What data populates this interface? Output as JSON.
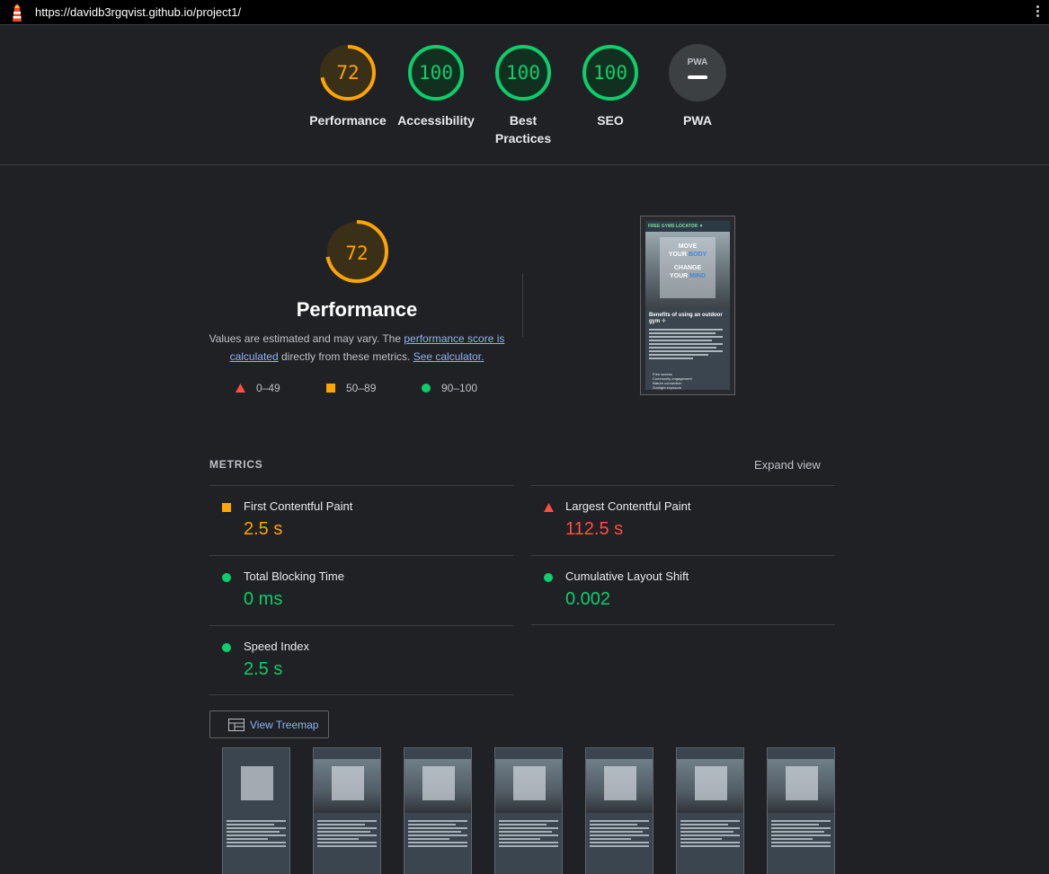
{
  "browser": {
    "url": "https://davidb3rgqvist.github.io/project1/"
  },
  "summary": {
    "categories": [
      {
        "label": "Performance",
        "score": "72",
        "color": "#ffa400"
      },
      {
        "label": "Accessibility",
        "score": "100",
        "color": "#0cce6b"
      },
      {
        "label": "Best Practices",
        "score": "100",
        "color": "#0cce6b"
      },
      {
        "label": "SEO",
        "score": "100",
        "color": "#0cce6b"
      },
      {
        "label": "PWA",
        "score": "",
        "badge": "PWA",
        "color": "#5f6368"
      }
    ]
  },
  "performance": {
    "score": "72",
    "title": "Performance",
    "desc_prefix": "Values are estimated and may vary. The ",
    "desc_link1": "performance score is calculated",
    "desc_mid": " directly from these metrics. ",
    "desc_link2": "See calculator.",
    "legend": [
      {
        "range": "0–49",
        "shape": "triangle",
        "color": "#ff4e42"
      },
      {
        "range": "50–89",
        "shape": "square",
        "color": "#ffa400"
      },
      {
        "range": "90–100",
        "shape": "circle",
        "color": "#0cce6b"
      }
    ]
  },
  "screenshot": {
    "nav": "FREE GYMS LOCATOR ▼",
    "hero_line1": "MOVE",
    "hero_line2a": "YOUR ",
    "hero_line2b": "BODY",
    "hero_line3": "CHANGE",
    "hero_line4a": "YOUR ",
    "hero_line4b": "MIND",
    "heading": "Benefits of using an outdoor gym ✛",
    "list": [
      "Free access",
      "Community engagement",
      "Nature connection",
      "Sunlight exposure"
    ]
  },
  "metrics": {
    "heading": "METRICS",
    "expand_label": "Expand view",
    "items": [
      {
        "name": "First Contentful Paint",
        "value": "2.5 s",
        "rating": "average",
        "color": "#ffa400"
      },
      {
        "name": "Largest Contentful Paint",
        "value": "112.5 s",
        "rating": "fail",
        "color": "#ff4e42"
      },
      {
        "name": "Total Blocking Time",
        "value": "0 ms",
        "rating": "pass",
        "color": "#0cce6b"
      },
      {
        "name": "Cumulative Layout Shift",
        "value": "0.002",
        "rating": "pass",
        "color": "#0cce6b"
      },
      {
        "name": "Speed Index",
        "value": "2.5 s",
        "rating": "pass",
        "color": "#0cce6b"
      }
    ]
  },
  "treemap": {
    "label": "View Treemap",
    "icon": "treemap-icon"
  },
  "filmstrip": {
    "frames": 7
  }
}
